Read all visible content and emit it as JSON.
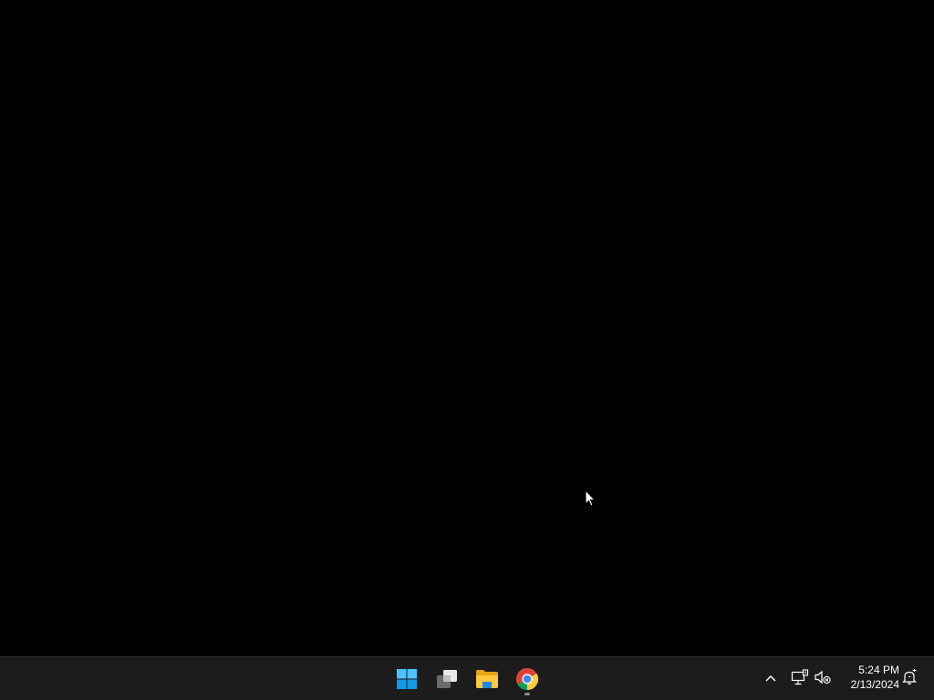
{
  "taskbar": {
    "start_button": {
      "icon": "windows-logo-icon",
      "accent": "#4cc2ff"
    },
    "pinned_apps": [
      {
        "id": "task-view",
        "icon": "task-view-icon"
      },
      {
        "id": "file-explorer",
        "icon": "folder-icon"
      },
      {
        "id": "chrome",
        "icon": "chrome-icon",
        "running": true
      }
    ],
    "tray": {
      "overflow_icon": "chevron-up-icon",
      "network_icon": "network-icon",
      "volume_icon": "volume-muted-icon",
      "notification_icon": "notification-bell-icon"
    },
    "clock": {
      "time": "5:24 PM",
      "date": "2/13/2024"
    }
  }
}
